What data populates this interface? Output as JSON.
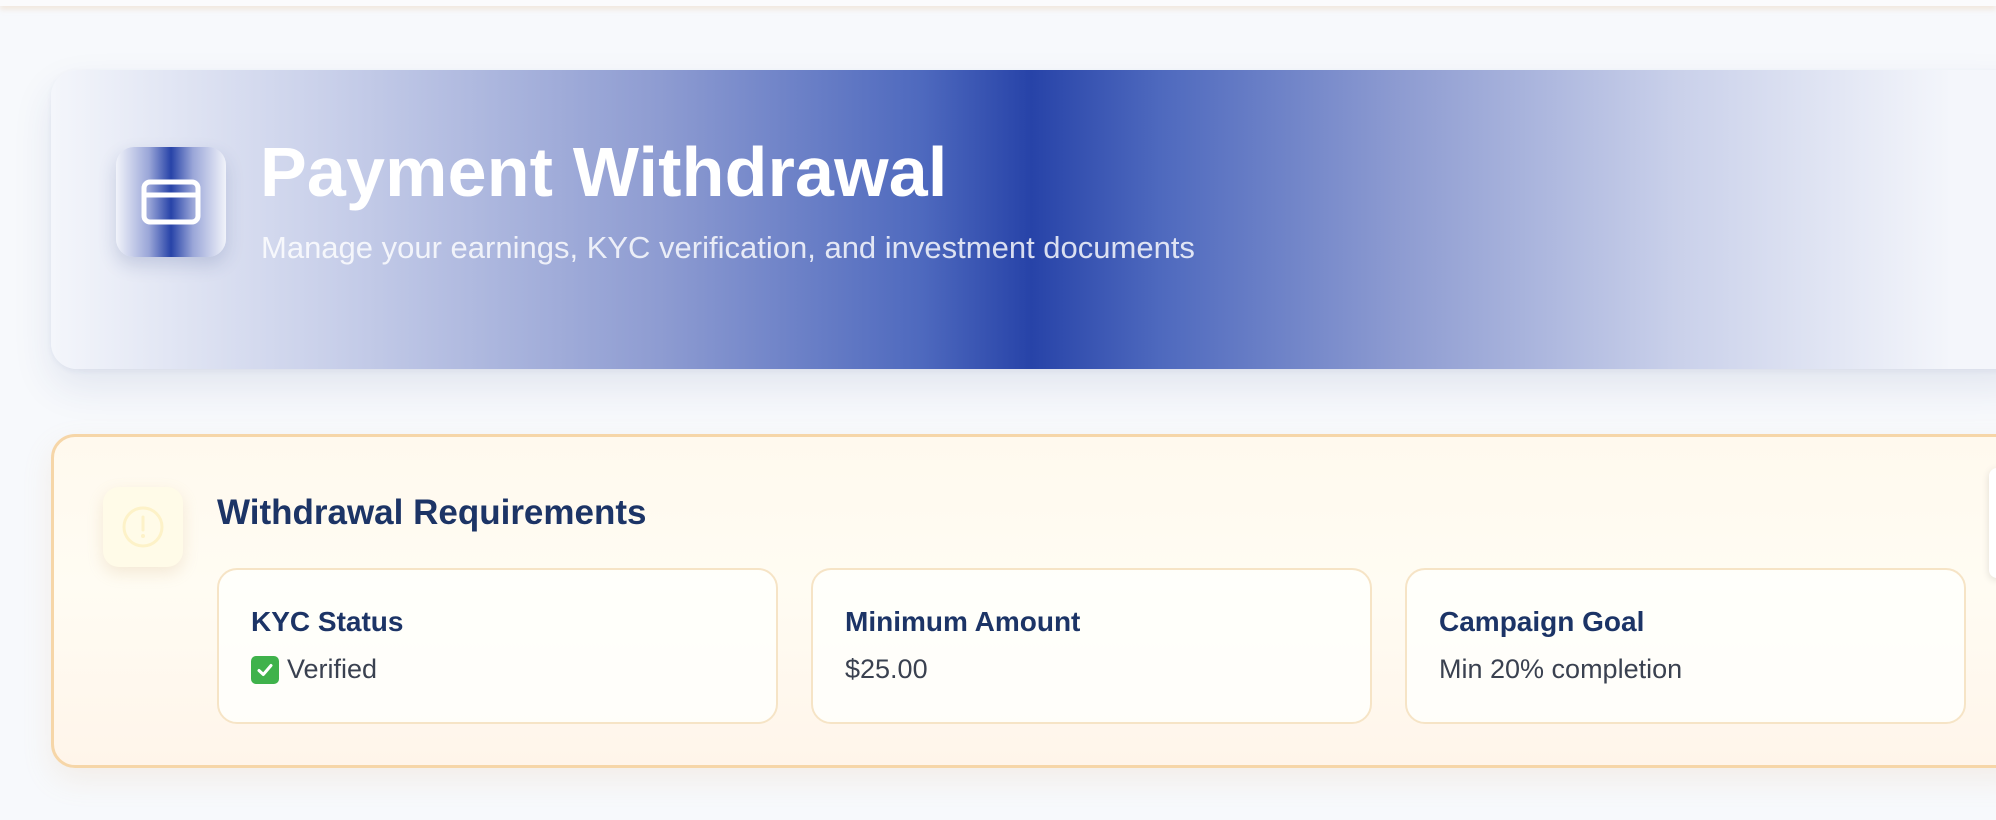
{
  "header": {
    "title": "Payment Withdrawal",
    "subtitle": "Manage your earnings, KYC verification, and investment documents",
    "icon": "credit-card-icon"
  },
  "requirements": {
    "title": "Withdrawal Requirements",
    "icon": "info-circle-icon",
    "cards": [
      {
        "label": "KYC Status",
        "value": "Verified",
        "icon": "check-box-icon"
      },
      {
        "label": "Minimum Amount",
        "value": "$25.00"
      },
      {
        "label": "Campaign Goal",
        "value": "Min 20% completion"
      }
    ]
  },
  "colors": {
    "brand_blue": "#2743a8",
    "heading_navy": "#1c3466",
    "panel_border": "#f6d6a8",
    "success_green": "#3fb24b"
  }
}
